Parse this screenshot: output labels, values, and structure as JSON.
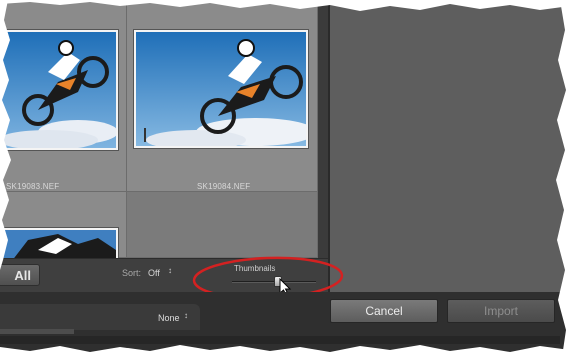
{
  "grid": {
    "thumbnails": [
      {
        "filename": "SK19083.NEF"
      },
      {
        "filename": "SK19084.NEF"
      },
      {
        "filename": ""
      }
    ]
  },
  "toolbar": {
    "all_label": "All",
    "sort_label": "Sort:",
    "sort_value": "Off",
    "sort_arrow": "↕",
    "thumbnails_label": "Thumbnails",
    "thumbnail_size_level": 0.55
  },
  "destination": {
    "value": "None",
    "arrow": "↕"
  },
  "actions": {
    "cancel_label": "Cancel",
    "import_label": "Import"
  },
  "colors": {
    "highlight_oval": "#d42121",
    "panel_bg": "#5f5f5f",
    "toolbar_bg": "#3f3f3f"
  },
  "icons": {
    "cursor": "pointer-cursor-icon",
    "sort": "sort-updown-icon"
  }
}
